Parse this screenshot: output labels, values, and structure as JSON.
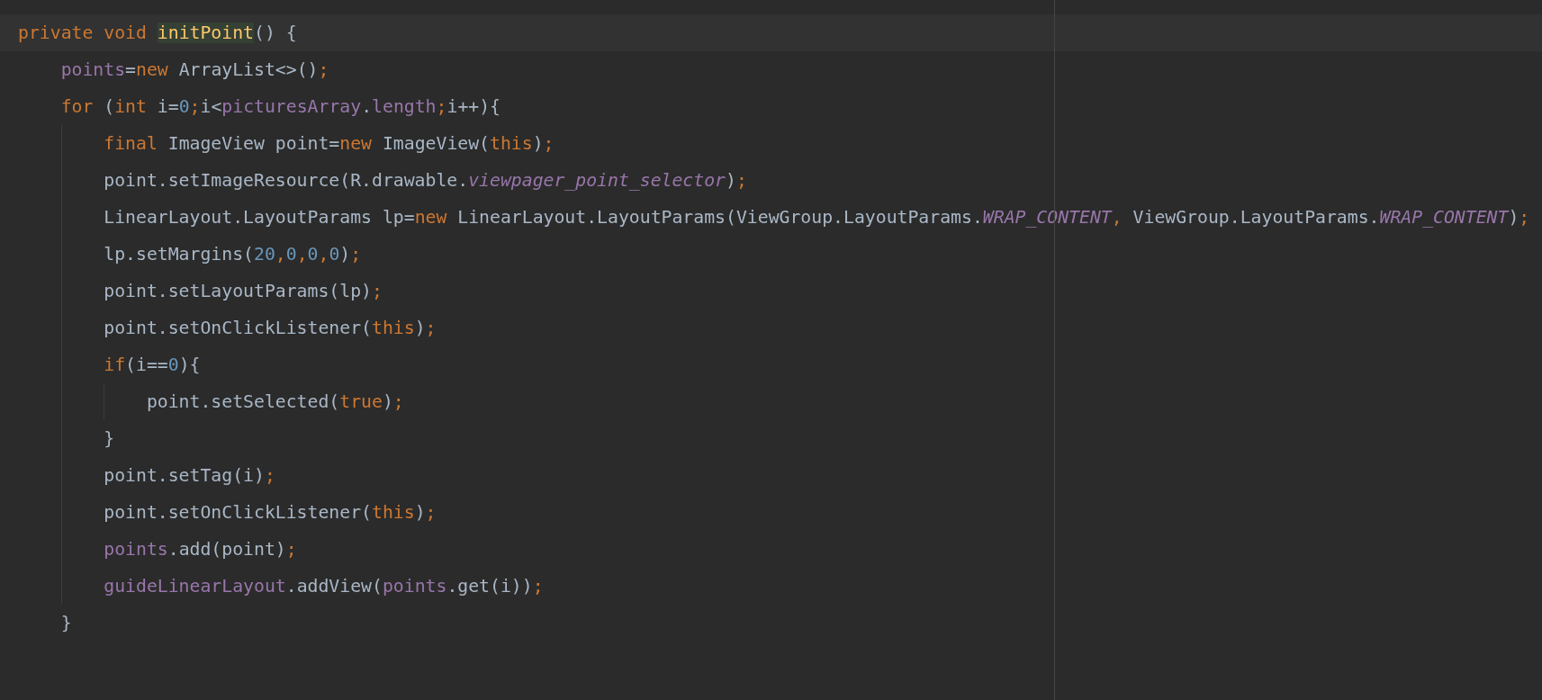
{
  "editor": {
    "lines": [
      {
        "current": true,
        "tokens": [
          {
            "text": "private void ",
            "kind": "keyword"
          },
          {
            "text": "initPoint",
            "kind": "declaration"
          },
          {
            "text": "() {",
            "kind": "plain"
          }
        ],
        "children": [
          {
            "current": false,
            "tokens": [
              {
                "text": "points",
                "kind": "field"
              },
              {
                "text": "=",
                "kind": "plain"
              },
              {
                "text": "new ",
                "kind": "keyword"
              },
              {
                "text": "ArrayList<>()",
                "kind": "plain"
              },
              {
                "text": ";",
                "kind": "keyword"
              }
            ]
          },
          {
            "current": false,
            "tokens": [
              {
                "text": "for ",
                "kind": "keyword"
              },
              {
                "text": "(",
                "kind": "plain"
              },
              {
                "text": "int ",
                "kind": "keyword"
              },
              {
                "text": "i=",
                "kind": "plain"
              },
              {
                "text": "0",
                "kind": "number"
              },
              {
                "text": ";",
                "kind": "keyword"
              },
              {
                "text": "i<",
                "kind": "plain"
              },
              {
                "text": "picturesArray",
                "kind": "field"
              },
              {
                "text": ".",
                "kind": "plain"
              },
              {
                "text": "length",
                "kind": "field"
              },
              {
                "text": ";",
                "kind": "keyword"
              },
              {
                "text": "i++){",
                "kind": "plain"
              }
            ],
            "children": [
              {
                "current": false,
                "tokens": [
                  {
                    "text": "final ",
                    "kind": "keyword"
                  },
                  {
                    "text": "ImageView point=",
                    "kind": "plain"
                  },
                  {
                    "text": "new ",
                    "kind": "keyword"
                  },
                  {
                    "text": "ImageView(",
                    "kind": "plain"
                  },
                  {
                    "text": "this",
                    "kind": "keyword"
                  },
                  {
                    "text": ")",
                    "kind": "plain"
                  },
                  {
                    "text": ";",
                    "kind": "keyword"
                  }
                ]
              },
              {
                "current": false,
                "tokens": [
                  {
                    "text": "point.setImageResource(R.drawable.",
                    "kind": "plain"
                  },
                  {
                    "text": "viewpager_point_selector",
                    "kind": "static"
                  },
                  {
                    "text": ")",
                    "kind": "plain"
                  },
                  {
                    "text": ";",
                    "kind": "keyword"
                  }
                ]
              },
              {
                "current": false,
                "tokens": [
                  {
                    "text": "LinearLayout.LayoutParams lp=",
                    "kind": "plain"
                  },
                  {
                    "text": "new ",
                    "kind": "keyword"
                  },
                  {
                    "text": "LinearLayout.LayoutParams(ViewGroup.LayoutParams.",
                    "kind": "plain"
                  },
                  {
                    "text": "WRAP_CONTENT",
                    "kind": "static"
                  },
                  {
                    "text": ", ",
                    "kind": "keyword"
                  },
                  {
                    "text": "ViewGroup.LayoutParams.",
                    "kind": "plain"
                  },
                  {
                    "text": "WRAP_CONTENT",
                    "kind": "static"
                  },
                  {
                    "text": ")",
                    "kind": "plain"
                  },
                  {
                    "text": ";",
                    "kind": "keyword"
                  }
                ]
              },
              {
                "current": false,
                "tokens": [
                  {
                    "text": "lp.setMargins(",
                    "kind": "plain"
                  },
                  {
                    "text": "20",
                    "kind": "number"
                  },
                  {
                    "text": ",",
                    "kind": "keyword"
                  },
                  {
                    "text": "0",
                    "kind": "number"
                  },
                  {
                    "text": ",",
                    "kind": "keyword"
                  },
                  {
                    "text": "0",
                    "kind": "number"
                  },
                  {
                    "text": ",",
                    "kind": "keyword"
                  },
                  {
                    "text": "0",
                    "kind": "number"
                  },
                  {
                    "text": ")",
                    "kind": "plain"
                  },
                  {
                    "text": ";",
                    "kind": "keyword"
                  }
                ]
              },
              {
                "current": false,
                "tokens": [
                  {
                    "text": "point.setLayoutParams(lp)",
                    "kind": "plain"
                  },
                  {
                    "text": ";",
                    "kind": "keyword"
                  }
                ]
              },
              {
                "current": false,
                "tokens": [
                  {
                    "text": "point.setOnClickListener(",
                    "kind": "plain"
                  },
                  {
                    "text": "this",
                    "kind": "keyword"
                  },
                  {
                    "text": ")",
                    "kind": "plain"
                  },
                  {
                    "text": ";",
                    "kind": "keyword"
                  }
                ]
              },
              {
                "current": false,
                "tokens": [
                  {
                    "text": "if",
                    "kind": "keyword"
                  },
                  {
                    "text": "(i==",
                    "kind": "plain"
                  },
                  {
                    "text": "0",
                    "kind": "number"
                  },
                  {
                    "text": "){",
                    "kind": "plain"
                  }
                ],
                "children": [
                  {
                    "current": false,
                    "tokens": [
                      {
                        "text": "point.setSelected(",
                        "kind": "plain"
                      },
                      {
                        "text": "true",
                        "kind": "keyword"
                      },
                      {
                        "text": ")",
                        "kind": "plain"
                      },
                      {
                        "text": ";",
                        "kind": "keyword"
                      }
                    ]
                  }
                ]
              },
              {
                "current": false,
                "tokens": [
                  {
                    "text": "}",
                    "kind": "plain"
                  }
                ]
              },
              {
                "current": false,
                "tokens": [
                  {
                    "text": "point.setTag(i)",
                    "kind": "plain"
                  },
                  {
                    "text": ";",
                    "kind": "keyword"
                  }
                ]
              },
              {
                "current": false,
                "tokens": [
                  {
                    "text": "point.setOnClickListener(",
                    "kind": "plain"
                  },
                  {
                    "text": "this",
                    "kind": "keyword"
                  },
                  {
                    "text": ")",
                    "kind": "plain"
                  },
                  {
                    "text": ";",
                    "kind": "keyword"
                  }
                ]
              },
              {
                "current": false,
                "tokens": [
                  {
                    "text": "points",
                    "kind": "field"
                  },
                  {
                    "text": ".add(point)",
                    "kind": "plain"
                  },
                  {
                    "text": ";",
                    "kind": "keyword"
                  }
                ]
              },
              {
                "current": false,
                "tokens": [
                  {
                    "text": "guideLinearLayout",
                    "kind": "field"
                  },
                  {
                    "text": ".addView(",
                    "kind": "plain"
                  },
                  {
                    "text": "points",
                    "kind": "field"
                  },
                  {
                    "text": ".get(i))",
                    "kind": "plain"
                  },
                  {
                    "text": ";",
                    "kind": "keyword"
                  }
                ]
              }
            ]
          },
          {
            "current": false,
            "tokens": [
              {
                "text": "}",
                "kind": "plain"
              }
            ]
          }
        ]
      }
    ]
  }
}
